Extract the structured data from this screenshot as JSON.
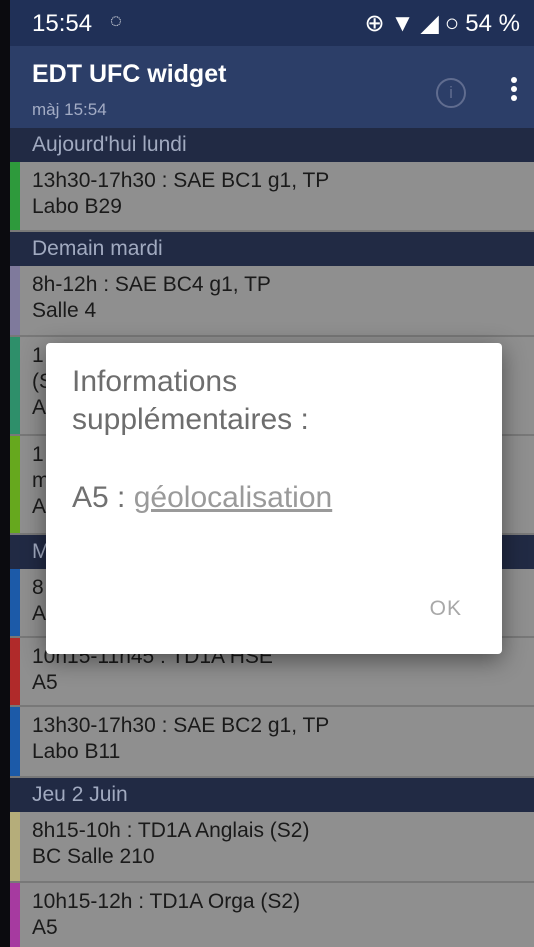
{
  "status_bar": {
    "time": "15:54",
    "battery": "54 %"
  },
  "app_bar": {
    "title": "EDT UFC widget",
    "subtitle": "màj 15:54",
    "info_icon": "i"
  },
  "schedule": {
    "today_header": "Aujourd'hui lundi",
    "today_events": [
      {
        "line1": "13h30-17h30 : SAE BC1 g1, TP",
        "line2": "Labo B29",
        "color": "#2e9a3c"
      }
    ],
    "tomorrow_header": "Demain mardi",
    "tomorrow_events": [
      {
        "line1": "8h-12h : SAE BC4 g1, TP",
        "line2": "Salle 4",
        "color": "#7f7a9c"
      },
      {
        "line1": "1",
        "line2": "(S",
        "line3": "A",
        "color": "#2e8f6a"
      },
      {
        "line1": "1",
        "line2": "m",
        "line3": "A",
        "color": "#66a81e"
      }
    ],
    "wednesday_header": "M",
    "wednesday_events": [
      {
        "line1": "8",
        "line2": "A",
        "color": "#1c5aa8"
      },
      {
        "line1": "10h15-11h45 : TD1A HSE'",
        "line2": "A5",
        "color": "#b02a2a"
      },
      {
        "line1": "13h30-17h30 : SAE BC2 g1, TP",
        "line2": "Labo B11",
        "color": "#1c5aa8"
      }
    ],
    "thursday_header": "Jeu 2 Juin",
    "thursday_events": [
      {
        "line1": "8h15-10h : TD1A Anglais (S2)",
        "line2": "BC Salle 210",
        "color": "#b5ad7a"
      },
      {
        "line1": "10h15-12h : TD1A Orga (S2)",
        "line2": "A5",
        "color": "#a63aa0"
      }
    ]
  },
  "dialog": {
    "title": "Informations supplémentaires :",
    "room": "A5",
    "separator": " : ",
    "link_text": "géolocalisation",
    "ok_label": "OK"
  }
}
